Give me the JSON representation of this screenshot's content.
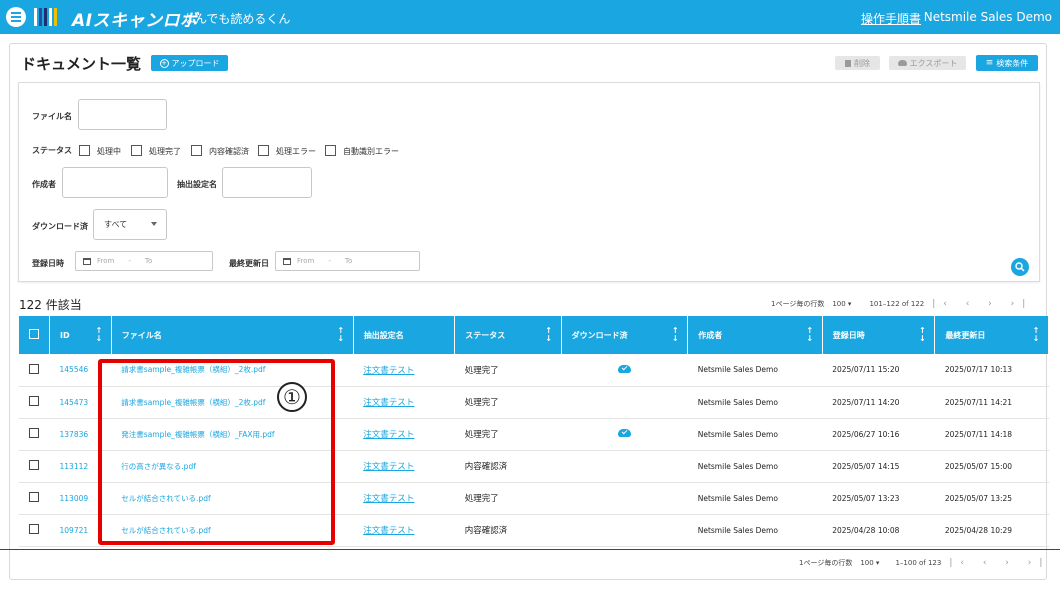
{
  "header": {
    "brand_name": "AIスキャンロボ",
    "brand_tagline": "なんでも読めるくん",
    "manual_link": "操作手順書",
    "user_name": "Netsmile Sales Demo"
  },
  "page": {
    "title": "ドキュメント一覧",
    "upload_label": "アップロード",
    "delete_label": "削除",
    "export_label": "エクスポート",
    "search_conditions_label": "検索条件"
  },
  "filters": {
    "file_name_label": "ファイル名",
    "status_label": "ステータス",
    "status_options": [
      "処理中",
      "処理完了",
      "内容確認済",
      "処理エラー",
      "自動識別エラー"
    ],
    "creator_label": "作成者",
    "extraction_setting_label": "抽出設定名",
    "downloaded_label": "ダウンロード済",
    "downloaded_value": "すべて",
    "registered_label": "登録日時",
    "updated_label": "最終更新日",
    "from_placeholder": "From",
    "to_placeholder": "To",
    "range_sep": "-"
  },
  "results": {
    "count_text": "122 件該当",
    "rows_per_page_label": "1ページ毎の行数",
    "rows_per_page_value": "100",
    "range_text": "101–122 of 122"
  },
  "table": {
    "headers": [
      "ID",
      "ファイル名",
      "抽出設定名",
      "ステータス",
      "ダウンロード済",
      "作成者",
      "登録日時",
      "最終更新日"
    ],
    "rows": [
      {
        "id": "145546",
        "file": "請求書sample_複雑帳票（横組）_2枚.pdf",
        "setting": "注文書テスト",
        "status": "処理完了",
        "downloaded": true,
        "creator": "Netsmile Sales Demo",
        "registered": "2025/07/11 15:20",
        "updated": "2025/07/17 10:13"
      },
      {
        "id": "145473",
        "file": "請求書sample_複雑帳票（横組）_2枚.pdf",
        "setting": "注文書テスト",
        "status": "処理完了",
        "downloaded": false,
        "creator": "Netsmile Sales Demo",
        "registered": "2025/07/11 14:20",
        "updated": "2025/07/11 14:21"
      },
      {
        "id": "137836",
        "file": "発注書sample_複雑帳票（横組）_FAX用.pdf",
        "setting": "注文書テスト",
        "status": "処理完了",
        "downloaded": true,
        "creator": "Netsmile Sales Demo",
        "registered": "2025/06/27 10:16",
        "updated": "2025/07/11 14:18"
      },
      {
        "id": "113112",
        "file": "行の高さが異なる.pdf",
        "setting": "注文書テスト",
        "status": "内容確認済",
        "downloaded": false,
        "creator": "Netsmile Sales Demo",
        "registered": "2025/05/07 14:15",
        "updated": "2025/05/07 15:00"
      },
      {
        "id": "113009",
        "file": "セルが結合されている.pdf",
        "setting": "注文書テスト",
        "status": "処理完了",
        "downloaded": false,
        "creator": "Netsmile Sales Demo",
        "registered": "2025/05/07 13:23",
        "updated": "2025/05/07 13:25"
      },
      {
        "id": "109721",
        "file": "セルが結合されている.pdf",
        "setting": "注文書テスト",
        "status": "内容確認済",
        "downloaded": false,
        "creator": "Netsmile Sales Demo",
        "registered": "2025/04/28 10:08",
        "updated": "2025/04/28 10:29"
      }
    ]
  },
  "footer_pager": {
    "rows_per_page_label": "1ページ毎の行数",
    "rows_per_page_value": "100",
    "range_text": "1–100 of 123"
  },
  "annotation": {
    "marker": "①",
    "color": "#e60000"
  },
  "colors": {
    "accent": "#1aa6e0"
  }
}
